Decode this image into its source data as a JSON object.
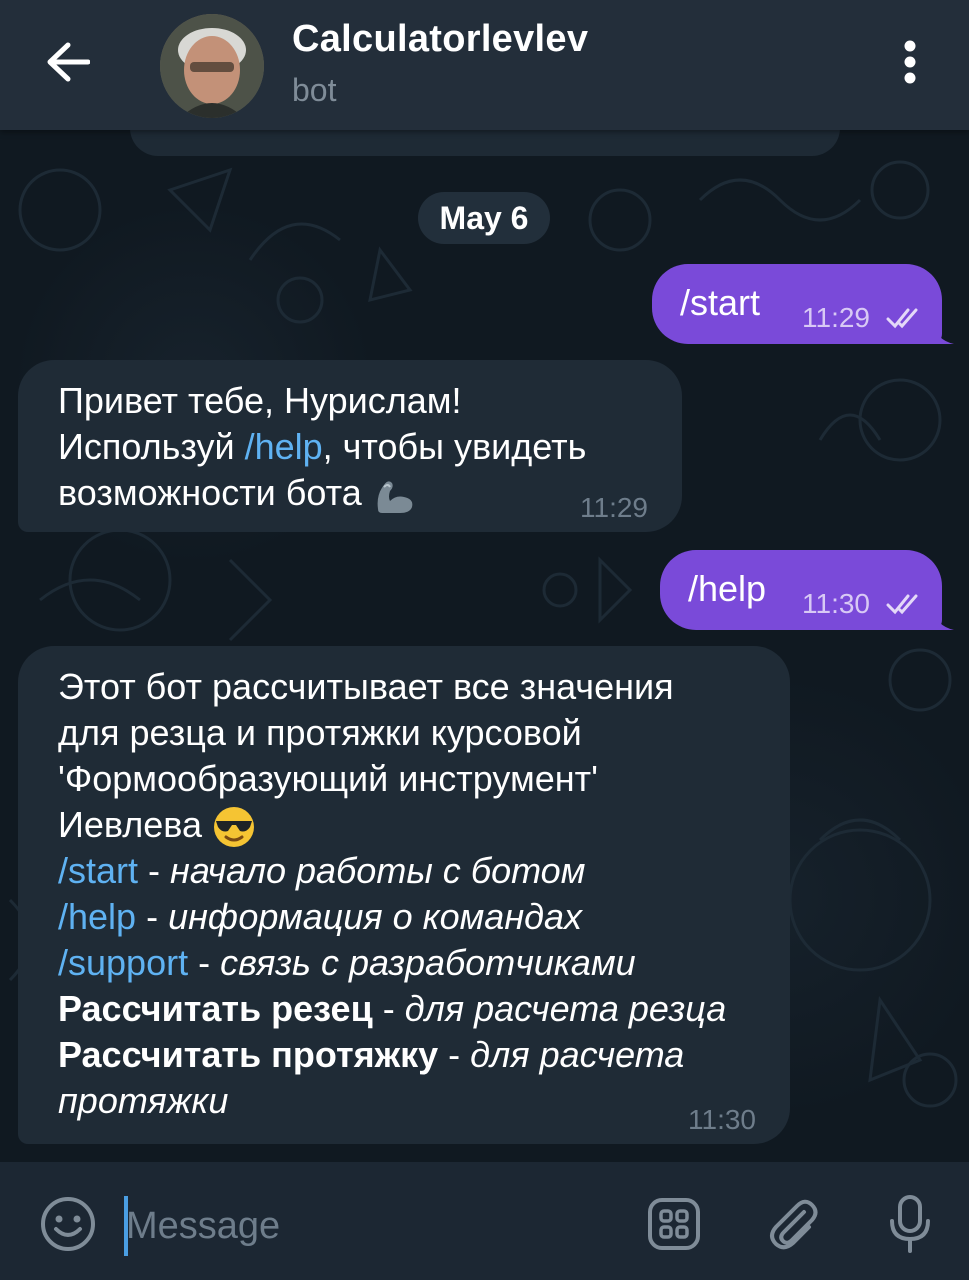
{
  "header": {
    "title": "Calculatorlevlev",
    "subtitle": "bot"
  },
  "date_separator": "May 6",
  "messages": [
    {
      "direction": "out",
      "text": "/start",
      "time": "11:29"
    },
    {
      "direction": "in",
      "lines": {
        "l1": "Привет тебе, Нурислам!",
        "l2_a": "Используй ",
        "l2_link": "/help",
        "l2_b": ", чтобы увидеть",
        "l3": "возможности бота "
      },
      "time": "11:29"
    },
    {
      "direction": "out",
      "text": "/help",
      "time": "11:30"
    },
    {
      "direction": "in",
      "lines": {
        "l1": "Этот бот рассчитывает все значения",
        "l2": "для резца и протяжки курсовой",
        "l3": "'Формообразующий инструмент'",
        "l4": "Иевлева ",
        "cmd1": "/start",
        "cmd1_sep": " -  ",
        "cmd1_desc": "начало работы с ботом",
        "cmd2": "/help",
        "cmd2_sep": " - ",
        "cmd2_desc": "информация о командах",
        "cmd3": "/support",
        "cmd3_sep": " - ",
        "cmd3_desc": "связь с разработчиками",
        "cmd4": "Рассчитать резец",
        "cmd4_sep": " - ",
        "cmd4_desc": "для расчета резца",
        "cmd5": "Рассчитать протяжку",
        "cmd5_sep": " - ",
        "cmd5_desc": "для расчета",
        "cmd5_desc2": "протяжки"
      },
      "time": "11:30"
    }
  ],
  "input": {
    "placeholder": "Message"
  },
  "icons": {
    "back": "arrow-left-icon",
    "menu": "more-vertical-icon",
    "emoji": "smiley-icon",
    "keyboard": "bot-keyboard-icon",
    "attach": "paperclip-icon",
    "mic": "microphone-icon",
    "read": "double-check-icon"
  },
  "colors": {
    "outgoing_bubble": "#7a4ad9",
    "incoming_bubble": "#1f2b36",
    "link": "#5fb2f2",
    "header": "#232e3a"
  }
}
